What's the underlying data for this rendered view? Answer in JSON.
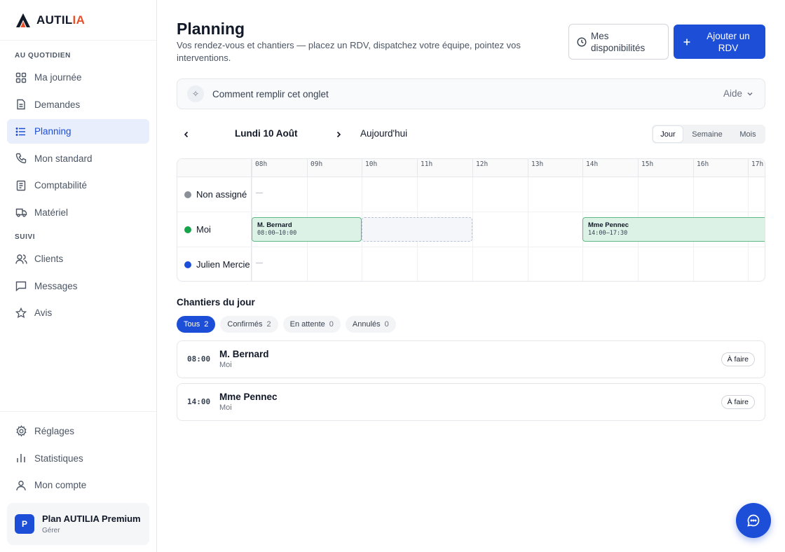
{
  "brand": {
    "name_a": "AUTIL",
    "name_b": "IA"
  },
  "sidebar": {
    "section_daily": "AU QUOTIDIEN",
    "daily_items": [
      {
        "label": "Ma journée",
        "icon": "grid-icon"
      },
      {
        "label": "Demandes",
        "icon": "document-icon"
      },
      {
        "label": "Planning",
        "icon": "list-icon",
        "active": true
      },
      {
        "label": "Mon standard",
        "icon": "phone-icon"
      },
      {
        "label": "Comptabilité",
        "icon": "receipt-icon"
      },
      {
        "label": "Matériel",
        "icon": "truck-icon"
      }
    ],
    "section_follow": "SUIVI",
    "follow_items": [
      {
        "label": "Clients",
        "icon": "users-icon"
      },
      {
        "label": "Messages",
        "icon": "message-icon"
      },
      {
        "label": "Avis",
        "icon": "star-icon"
      }
    ],
    "bottom_items": [
      {
        "label": "Réglages",
        "icon": "gear-icon"
      },
      {
        "label": "Statistiques",
        "icon": "bar-chart-icon"
      },
      {
        "label": "Mon compte",
        "icon": "user-icon"
      }
    ],
    "plan": {
      "avatar": "P",
      "title": "Plan AUTILIA Premium",
      "manage": "Gérer"
    }
  },
  "header": {
    "title": "Planning",
    "description": "Vos rendez-vous et chantiers — placez un RDV, dispatchez votre équipe, pointez vos interventions.",
    "availability_button": "Mes disponibilités",
    "add_button": "Ajouter un RDV"
  },
  "help": {
    "text": "Comment remplir cet onglet",
    "aide": "Aide"
  },
  "date_nav": {
    "date": "Lundi 10 Août",
    "today": "Aujourd'hui"
  },
  "views": {
    "day": "Jour",
    "week": "Semaine",
    "month": "Mois",
    "active": "day"
  },
  "schedule": {
    "hours": [
      "08h",
      "09h",
      "10h",
      "11h",
      "12h",
      "13h",
      "14h",
      "15h",
      "16h",
      "17h"
    ],
    "empty_marker": "—",
    "rows": [
      {
        "name": "Non assigné",
        "color": "#8b8f97",
        "events": []
      },
      {
        "name": "Moi",
        "color": "#16a34a",
        "events": [
          {
            "name": "M. Bernard",
            "time": "08:00–10:00"
          },
          {
            "name": "Mme Pennec",
            "time": "14:00–17:30"
          }
        ]
      },
      {
        "name": "Julien Mercier",
        "color": "#1d4ed8",
        "events": []
      }
    ]
  },
  "chantiers": {
    "title": "Chantiers du jour",
    "filters": [
      {
        "label": "Tous",
        "count": "2",
        "active": true
      },
      {
        "label": "Confirmés",
        "count": "2"
      },
      {
        "label": "En attente",
        "count": "0"
      },
      {
        "label": "Annulés",
        "count": "0"
      }
    ],
    "jobs": [
      {
        "time": "08:00",
        "name": "M. Bernard",
        "who": "Moi",
        "status": "À faire"
      },
      {
        "time": "14:00",
        "name": "Mme Pennec",
        "who": "Moi",
        "status": "À faire"
      }
    ]
  },
  "colors": {
    "accent": "#1d4ed8",
    "event_bg": "#dcf2e6",
    "event_border": "#5fb985",
    "logo_orange": "#e8502a"
  }
}
